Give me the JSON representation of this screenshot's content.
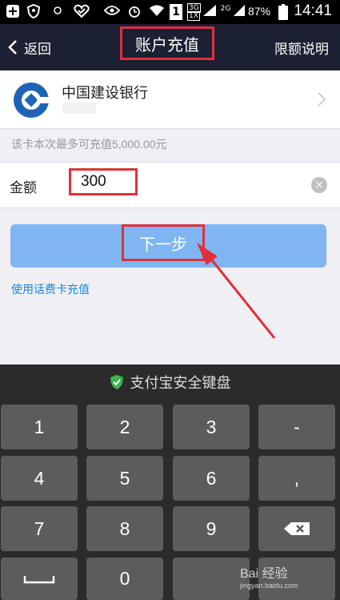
{
  "status_bar": {
    "battery_percent": "87%",
    "time": "14:41",
    "signal_label_top": "3G",
    "signal_label_bottom": "1X",
    "signal_label_2": "2G",
    "sim_badge": "1"
  },
  "nav": {
    "back_label": "返回",
    "title": "账户充值",
    "right_link": "限额说明"
  },
  "bank": {
    "name": "中国建设银行"
  },
  "limit_note": "该卡本次最多可充值5,000.00元",
  "amount": {
    "label": "金额",
    "value": "300"
  },
  "next_button": "下一步",
  "phonecard_link": "使用话费卡充值",
  "keyboard": {
    "header": "支付宝安全键盘",
    "keys": [
      "1",
      "2",
      "3",
      "-",
      "4",
      "5",
      "6",
      ",",
      "7",
      "8",
      "9",
      "0"
    ]
  },
  "watermark": {
    "main": "Bai 经验",
    "sub": "jingyan.baidu.com"
  },
  "colors": {
    "nav_bg": "#1c2033",
    "next_btn": "#7fb6f1",
    "highlight": "#e0303a",
    "link": "#1b86e0",
    "keyboard_bg": "#2b2b2b",
    "key_bg": "#5c5c5c"
  }
}
